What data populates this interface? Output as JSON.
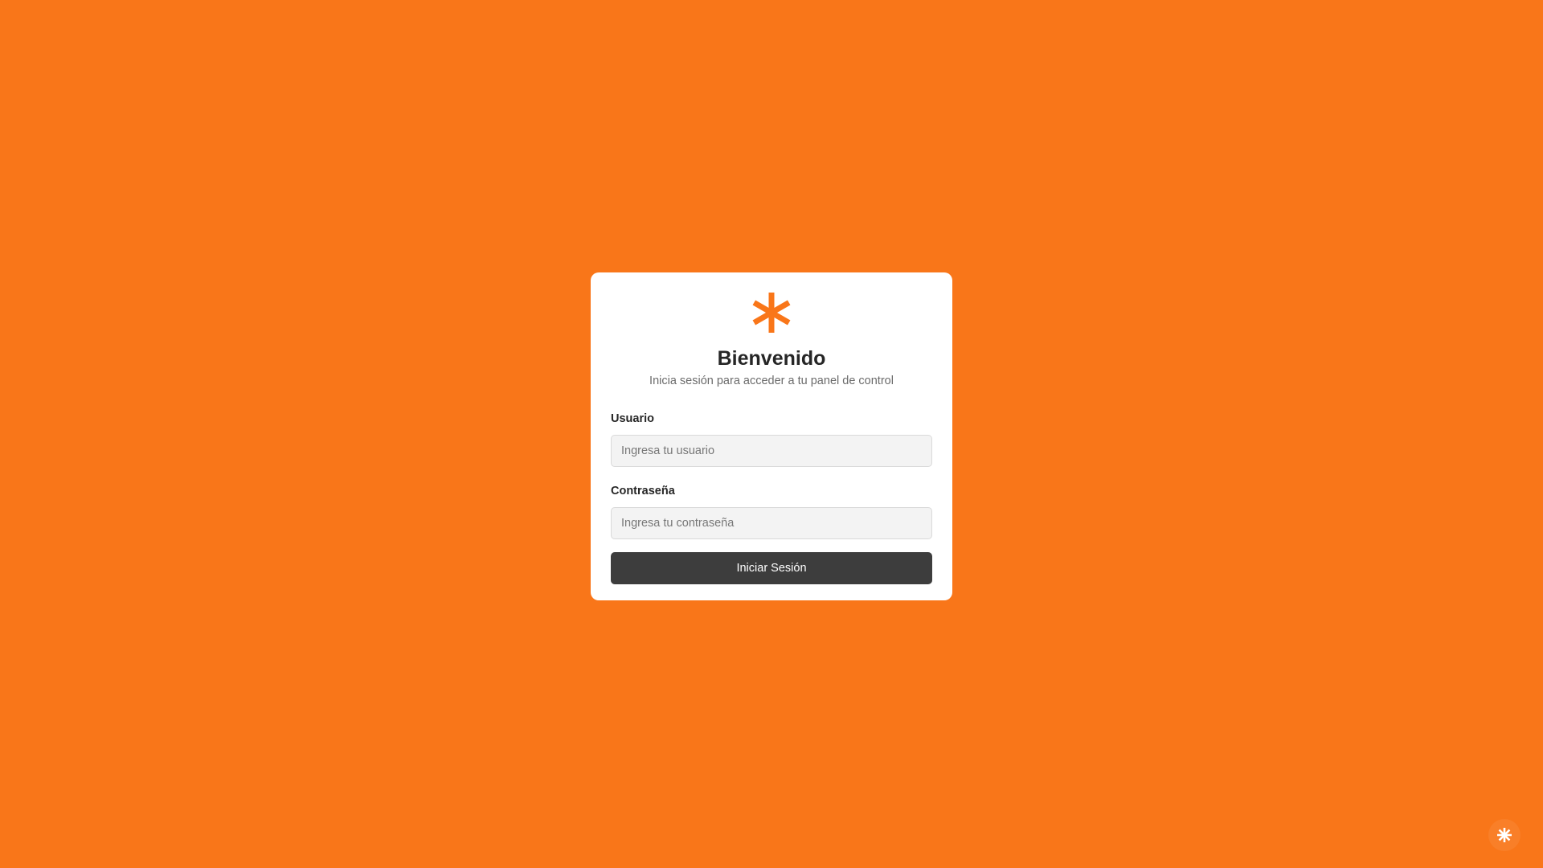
{
  "colors": {
    "background": "#f97619",
    "accent": "#f97619",
    "button": "#3d3d3d",
    "card": "#ffffff"
  },
  "login": {
    "logo_icon": "asterisk-icon",
    "title": "Bienvenido",
    "subtitle": "Inicia sesión para acceder a tu panel de control",
    "username": {
      "label": "Usuario",
      "placeholder": "Ingresa tu usuario",
      "value": ""
    },
    "password": {
      "label": "Contraseña",
      "placeholder": "Ingresa tu contraseña",
      "value": ""
    },
    "submit_label": "Iniciar Sesión"
  },
  "floating_button": {
    "icon": "sparkle-icon"
  }
}
